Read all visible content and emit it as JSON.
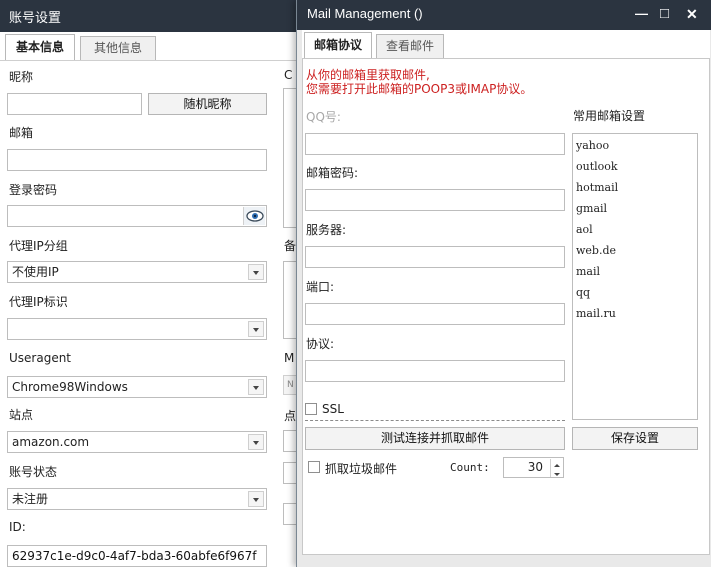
{
  "back_window": {
    "title": "账号设置",
    "tabs": [
      {
        "label": "基本信息",
        "active": true
      },
      {
        "label": "其他信息",
        "active": false
      }
    ],
    "fields": {
      "nickname_label": "昵称",
      "nickname_value": "",
      "random_nickname_button": "随机昵称",
      "email_label": "邮箱",
      "email_value": "",
      "login_password_label": "登录密码",
      "login_password_value": "",
      "proxy_group_label": "代理IP分组",
      "proxy_group_value": "不使用IP",
      "proxy_tag_label": "代理IP标识",
      "proxy_tag_value": "",
      "useragent_label": "Useragent",
      "useragent_value": "Chrome98Windows",
      "site_label": "站点",
      "site_value": "amazon.com",
      "status_label": "账号状态",
      "status_value": "未注册",
      "id_label": "ID:",
      "id_value": "62937c1e-d9c0-4af7-bda3-60abfe6f967f"
    },
    "partial": {
      "c_label": "C",
      "bei_label": "备",
      "m_label": "M",
      "n_label": "N",
      "dian_label": "点"
    }
  },
  "mail_window": {
    "title": "Mail Management  ()",
    "controls": {
      "minimize": "—",
      "maximize": "□",
      "close": "✕"
    },
    "tabs": [
      {
        "label": "邮箱协议",
        "active": true
      },
      {
        "label": "查看邮件",
        "active": false
      }
    ],
    "notice_line1": "从你的邮箱里获取邮件,",
    "notice_line2": "您需要打开此邮箱的POOP3或IMAP协议。",
    "form": {
      "qq_label": "QQ号:",
      "qq_value": "",
      "password_label": "邮箱密码:",
      "password_value": "",
      "server_label": "服务器:",
      "server_value": "",
      "port_label": "端口:",
      "port_value": "",
      "protocol_label": "协议:",
      "protocol_value": "",
      "ssl_label": "SSL",
      "test_button": "测试连接并抓取邮件",
      "spam_label": "抓取垃圾邮件",
      "count_label": "Count:",
      "count_value": "30"
    },
    "common": {
      "title": "常用邮箱设置",
      "items": [
        "yahoo",
        "outlook",
        "hotmail",
        "gmail",
        "aol",
        "web.de",
        "mail",
        "qq",
        "mail.ru"
      ],
      "save_button": "保存设置"
    }
  }
}
